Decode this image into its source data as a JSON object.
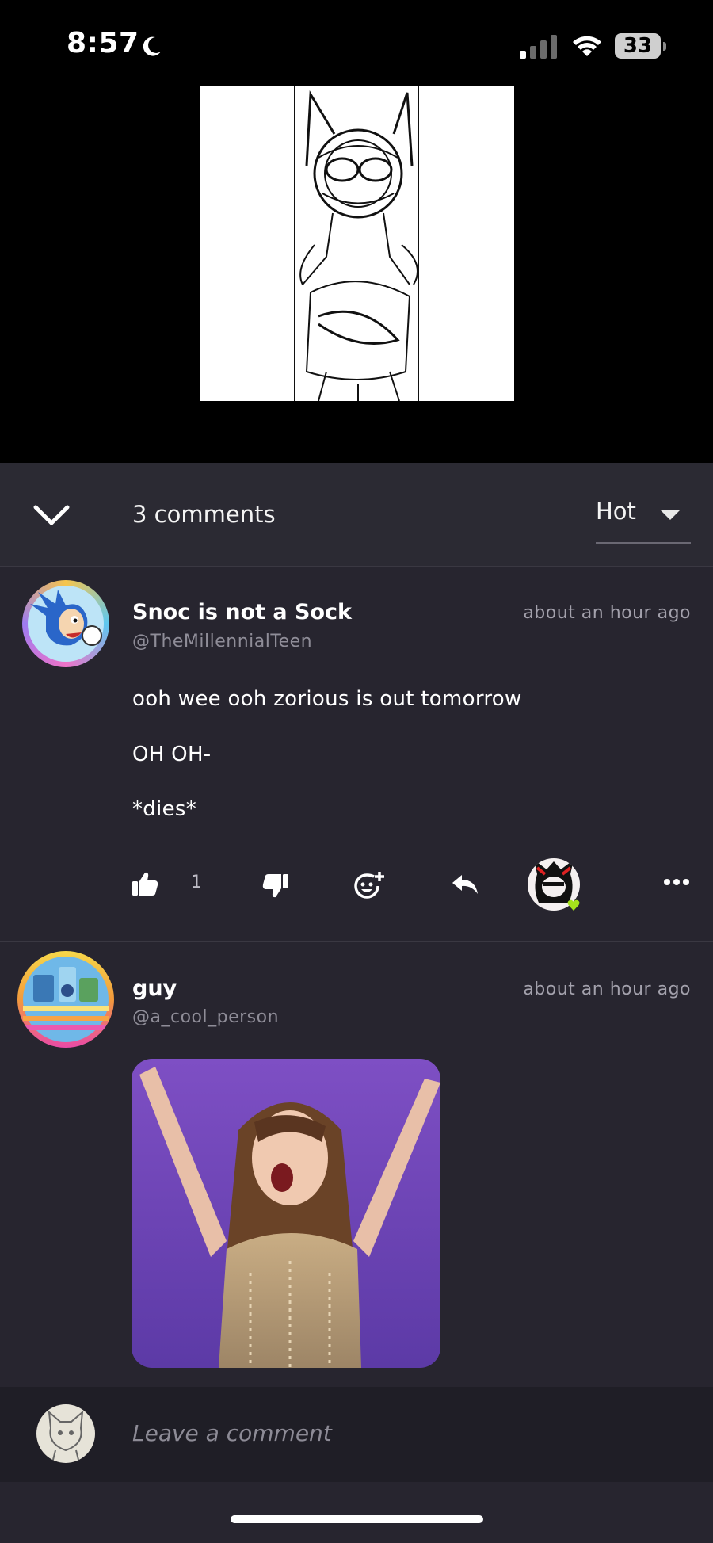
{
  "status_bar": {
    "time": "8:57",
    "battery": "33"
  },
  "header": {
    "comment_count": "3 comments",
    "sort_label": "Hot"
  },
  "comments": [
    {
      "username": "Snoc is not a Sock",
      "handle": "@TheMillennialTeen",
      "time": "about an hour ago",
      "lines": [
        "ooh wee ooh zorious is out tomorrow",
        "OH OH-",
        "*dies*"
      ],
      "likes": "1"
    },
    {
      "username": "guy",
      "handle": "@a_cool_person",
      "time": "about an hour ago"
    }
  ],
  "composer": {
    "placeholder": "Leave a comment"
  },
  "colors": {
    "background": "#27252f",
    "header_bg": "#2b2a33",
    "online_dot": "#a4e21c",
    "gif_purple": "#7a4fc0"
  }
}
